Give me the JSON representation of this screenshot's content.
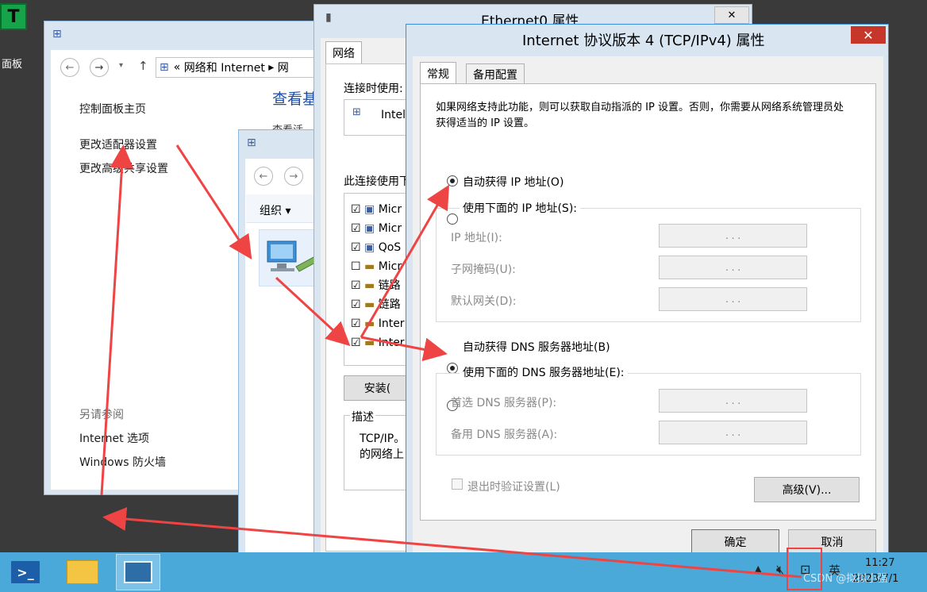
{
  "desktop": {
    "icon_glyph": "T",
    "label": "面板"
  },
  "control_panel": {
    "address_parts": [
      "«",
      "网络和 Internet",
      "▸",
      "网"
    ],
    "home_link": "控制面板主页",
    "adapter_link": "更改适配器设置",
    "sharing_link": "更改高级共享设置",
    "heading": "查看基",
    "sub_heading": "查看活",
    "see_also": "另请参阅",
    "internet_options": "Internet 选项",
    "firewall": "Windows 防火墙"
  },
  "network_connections": {
    "organize": "组织 ▾"
  },
  "ethernet": {
    "title": "Ethernet0 属性",
    "tab": "网络",
    "connect_using": "连接时使用:",
    "adapter": "Intel",
    "items_label": "此连接使用下",
    "items": [
      "Micr",
      "Micr",
      "QoS",
      "Micr",
      "链路",
      "链路",
      "Inter",
      "Inter"
    ],
    "install": "安装(",
    "description_label": "描述",
    "description": "TCP/IP。\n的网络上"
  },
  "ipv4": {
    "title": "Internet 协议版本 4 (TCP/IPv4) 属性",
    "tabs": [
      "常规",
      "备用配置"
    ],
    "intro": "如果网络支持此功能，则可以获取自动指派的 IP 设置。否则，你需要从网络系统管理员处获得适当的 IP 设置。",
    "auto_ip": "自动获得 IP 地址(O)",
    "manual_ip": "使用下面的 IP 地址(S):",
    "ip_address": "IP 地址(I):",
    "subnet": "子网掩码(U):",
    "gateway": "默认网关(D):",
    "auto_dns": "自动获得 DNS 服务器地址(B)",
    "manual_dns": "使用下面的 DNS 服务器地址(E):",
    "dns_pref": "首选 DNS 服务器(P):",
    "dns_alt": "备用 DNS 服务器(A):",
    "validate": "退出时验证设置(L)",
    "advanced": "高级(V)...",
    "ok": "确定",
    "cancel": "取消",
    "ip_dots": ". . ."
  },
  "taskbar": {
    "time": "11:27",
    "date": "2023/7/1",
    "ime": "英",
    "watermark": "CSDN @拟拟小强"
  },
  "colors": {
    "arrow": "#ef4444",
    "taskbar": "#4aa9d9"
  }
}
